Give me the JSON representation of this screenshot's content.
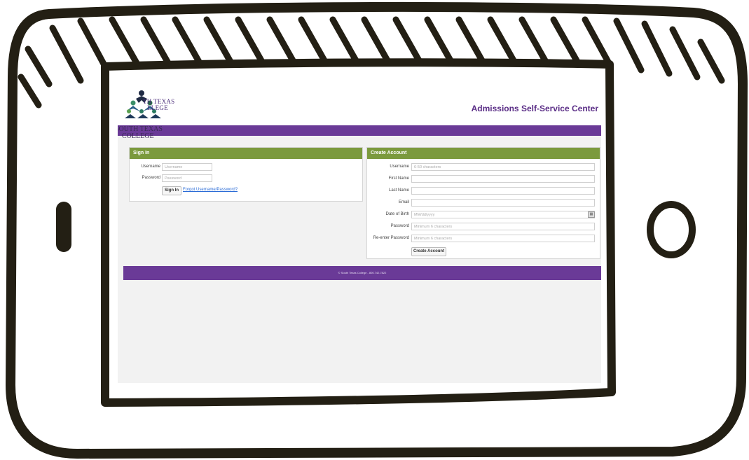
{
  "header": {
    "logo_line1": "TH TEXAS",
    "logo_line2": "LLEGE",
    "title": "Admissions Self-Service Center",
    "overlay_line1": "SOUTH TEXAS",
    "overlay_line2": "COLLEGE"
  },
  "signin": {
    "heading": "Sign In",
    "username_label": "Username",
    "username_placeholder": "Username",
    "password_label": "Password",
    "password_placeholder": "Password",
    "button": "Sign In",
    "forgot_link": "Forgot Username/Password?"
  },
  "create": {
    "heading": "Create Account",
    "fields": [
      {
        "label": "Username",
        "placeholder": "6-50 characters"
      },
      {
        "label": "First Name",
        "placeholder": ""
      },
      {
        "label": "Last Name",
        "placeholder": ""
      },
      {
        "label": "Email",
        "placeholder": ""
      },
      {
        "label": "Date of Birth",
        "placeholder": "MM/dd/yyyy"
      },
      {
        "label": "Password",
        "placeholder": "Minimum 6 characters"
      },
      {
        "label": "Re-enter Password",
        "placeholder": "Minimum 6 characters"
      }
    ],
    "button": "Create Account"
  },
  "footer": {
    "text": "© South Texas College - 800.742.7822"
  },
  "colors": {
    "purple": "#6a3a97",
    "green": "#7b9a3d",
    "title_purple": "#5a2d86"
  }
}
